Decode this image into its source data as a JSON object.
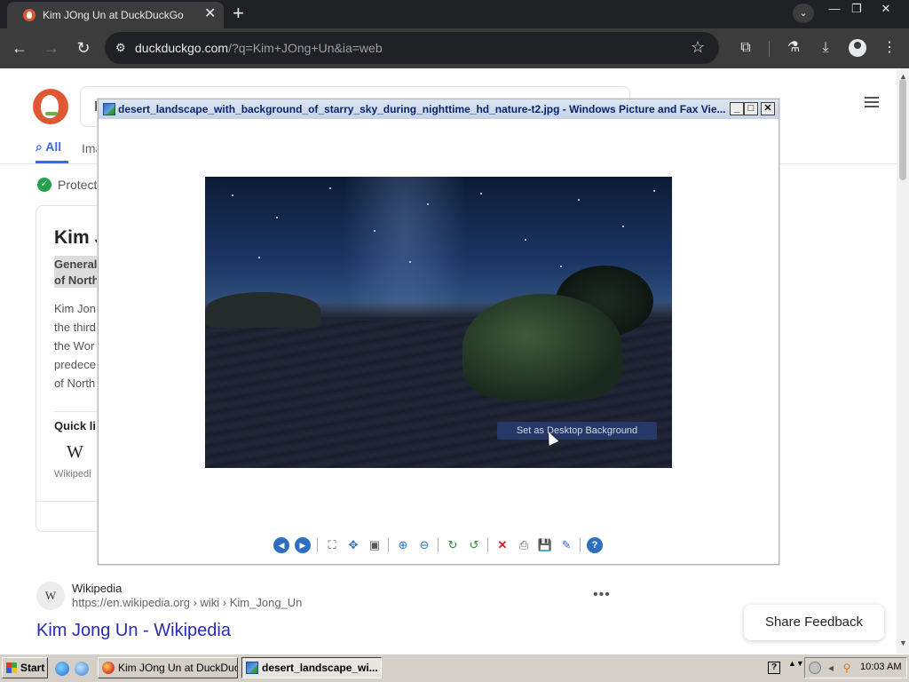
{
  "browser": {
    "tab_title": "Kim JOng Un at DuckDuckGo",
    "tab_close": "✕",
    "new_tab": "+",
    "tab_menu": "⌄",
    "window_controls": {
      "minimize": "—",
      "restore": "❐",
      "close": "✕"
    },
    "nav": {
      "back": "←",
      "forward": "→",
      "reload": "↻"
    },
    "url_host": "duckduckgo.com",
    "url_rest": "/?q=Kim+JOng+Un&ia=web",
    "icons": {
      "site_info": "⚙",
      "bookmark": "☆",
      "extensions": "⧉",
      "labs": "⚗",
      "downloads": "⤓",
      "menu": "⋮"
    }
  },
  "ddg": {
    "search_value": "K",
    "tab_all": "All",
    "tab_images": "Ima",
    "protection_text": "Protect",
    "kp": {
      "title": "Kim J",
      "sub_line1": "General",
      "sub_line2": "of North",
      "lines": [
        "Kim Jon",
        "the third",
        "the Wor",
        "predece",
        "of North"
      ],
      "quick_links": "Quick li",
      "wiki_glyph": "W",
      "wiki_label": "Wikipedi"
    },
    "result": {
      "favicon": "W",
      "site": "Wikipedia",
      "url": "https://en.wikipedia.org › wiki › Kim_Jong_Un",
      "more": "•••",
      "title": "Kim Jong Un - Wikipedia"
    },
    "share_feedback": "Share Feedback",
    "scroll": {
      "up": "▲",
      "down": "▼"
    }
  },
  "viewer": {
    "title": "desert_landscape_with_background_of_starry_sky_during_nighttime_hd_nature-t2.jpg - Windows Picture and Fax Vie...",
    "buttons": {
      "minimize": "_",
      "maximize": "□",
      "close": "✕"
    },
    "tooltip": "Set as Desktop Background",
    "toolbar": {
      "previous": "◀",
      "next": "▶",
      "best_fit": "⛶",
      "actual_size": "✥",
      "slideshow": "▣",
      "zoom_in": "⊕",
      "zoom_out": "⊖",
      "rotate_cw": "↻",
      "rotate_ccw": "↺",
      "delete": "✕",
      "print": "⎙",
      "save": "💾",
      "edit": "✎",
      "help": "?"
    }
  },
  "taskbar": {
    "start": "Start",
    "tasks": [
      {
        "label": "Kim JOng Un at DuckDuc..."
      },
      {
        "label": "desert_landscape_wi..."
      }
    ],
    "tray_help": "?",
    "tray_arrows": "▲▼",
    "clock": "10:03 AM"
  },
  "colors": {
    "ddg_orange": "#de5833",
    "ddg_blue": "#3969ef",
    "link_title": "#2a2ab8",
    "xp_title_text": "#0a246a",
    "taskbar": "#d4d0c8"
  }
}
